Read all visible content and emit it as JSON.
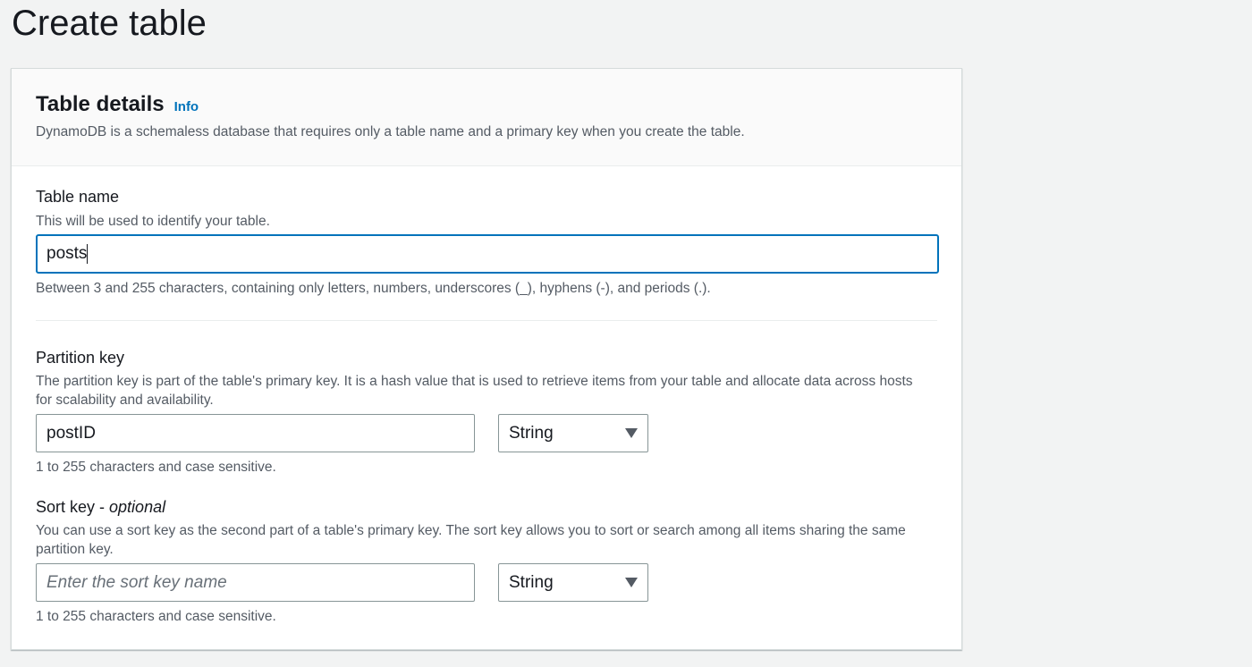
{
  "page": {
    "title": "Create table"
  },
  "panel": {
    "title": "Table details",
    "info_link": "Info",
    "description": "DynamoDB is a schemaless database that requires only a table name and a primary key when you create the table."
  },
  "table_name": {
    "label": "Table name",
    "description": "This will be used to identify your table.",
    "value": "posts",
    "constraint": "Between 3 and 255 characters, containing only letters, numbers, underscores (_), hyphens (-), and periods (.)."
  },
  "partition_key": {
    "label": "Partition key",
    "description": "The partition key is part of the table's primary key. It is a hash value that is used to retrieve items from your table and allocate data across hosts for scalability and availability.",
    "value": "postID",
    "type_selected": "String",
    "constraint": "1 to 255 characters and case sensitive."
  },
  "sort_key": {
    "label": "Sort key - ",
    "label_optional": "optional",
    "description": "You can use a sort key as the second part of a table's primary key. The sort key allows you to sort or search among all items sharing the same partition key.",
    "value": "",
    "placeholder": "Enter the sort key name",
    "type_selected": "String",
    "constraint": "1 to 255 characters and case sensitive."
  },
  "colors": {
    "page_background": "#f2f3f3",
    "link": "#0073bb",
    "focus_border": "#0073bb",
    "text_primary": "#16191f",
    "text_secondary": "#545b64"
  },
  "icons": {
    "select_caret": "caret-down-icon"
  }
}
